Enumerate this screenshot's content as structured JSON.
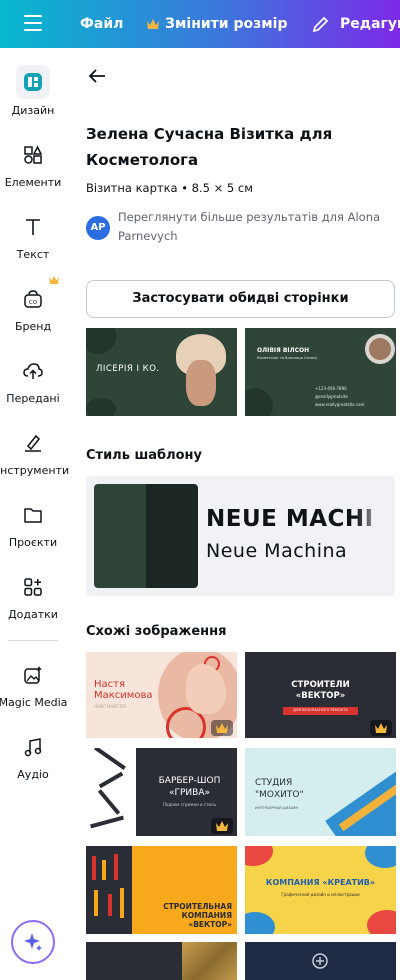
{
  "topbar": {
    "file_label": "Файл",
    "resize_label": "Змінити розмір",
    "edit_label": "Редагува"
  },
  "sidebar": {
    "items": [
      {
        "label": "Дизайн"
      },
      {
        "label": "Елементи"
      },
      {
        "label": "Текст"
      },
      {
        "label": "Бренд"
      },
      {
        "label": "Передані"
      },
      {
        "label": "Інструменти"
      },
      {
        "label": "Проєкти"
      },
      {
        "label": "Додатки"
      },
      {
        "label": "Magic Media"
      },
      {
        "label": "Аудіо"
      }
    ]
  },
  "template": {
    "title": "Зелена Сучасна Візитка для Косметолога",
    "subtitle": "Візитна картка • 8.5 × 5 см",
    "author_initials": "AP",
    "author_text": "Переглянути більше результатів для Alona Parnevych",
    "apply_button": "Застосувати обидві сторінки",
    "front_text": "ЛІСЕРІЯ І КО.",
    "back_name": "ОЛІВІЯ ВІЛСОН",
    "back_role": "Косметолог та Власниця Салону",
    "back_phone": "+123-456-7890",
    "back_handle": "@reallygreatsite",
    "back_site": "www.reallygreatsite.com"
  },
  "style_section": {
    "title": "Стиль шаблону",
    "font_heading": "NEUE MACHI",
    "font_body": "Neue Machina",
    "colors": [
      "#2e4437",
      "#1c2622"
    ]
  },
  "similar_section": {
    "title": "Схожі зображення",
    "cards": [
      {
        "line1": "Настя",
        "line2": "Максимова",
        "line3": "НАЙЛ МАЙСТЕР"
      },
      {
        "line1": "СТРОИТЕЛИ",
        "line2": "«ВЕКТОР»",
        "line3": "ДЛЯ БЕЗОПАСНОГО РЕМОНТА"
      },
      {
        "line1": "БАРБЕР-ШОП",
        "line2": "«ГРИВА»",
        "line3": "Подаем стрижки и стиль"
      },
      {
        "line1": "СТУДИЯ",
        "line2": "\"МОХИТО\"",
        "line3": "ИНТЕРЬЕРНЫЙ ДИЗАЙН"
      },
      {
        "line1": "СТРОИТЕЛЬНАЯ",
        "line2": "КОМПАНИЯ",
        "line3": "«ВЕКТОР»"
      },
      {
        "line1": "КОМПАНИЯ «КРЕАТИВ»",
        "line2": "Графический дизайн и иллюстрации",
        "line3": ""
      }
    ]
  },
  "colors": {
    "accent_teal": "#07b9ce",
    "accent_purple": "#7d2ae8",
    "crown_gold": "#f5b740"
  }
}
